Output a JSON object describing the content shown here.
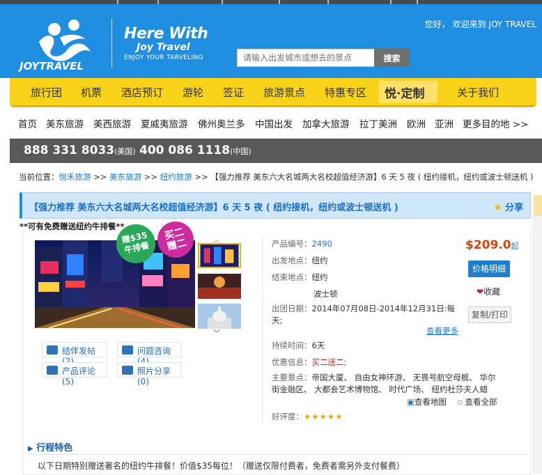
{
  "header": {
    "logo_text": "JOYTRAVEL",
    "slogan_line1": "Here With",
    "slogan_line2": "Joy Travel",
    "slogan_line3": "ENJOY YOUR TARVELING",
    "welcome": "您好， 欢迎来到 JOY TRAVEL",
    "search_placeholder": "请输入出发城市或想去的景点",
    "search_button": "搜索"
  },
  "main_nav": {
    "items": [
      "旅行团",
      "机票",
      "酒店预订",
      "游轮",
      "签证",
      "旅游景点",
      "特惠专区",
      "关于我们"
    ],
    "special": "悦·定制"
  },
  "sub_nav": {
    "items": [
      "首页",
      "美东旅游",
      "美西旅游",
      "夏威夷旅游",
      "佛州奥兰多",
      "中国出发",
      "加拿大旅游",
      "拉丁美洲",
      "欧洲",
      "亚洲",
      "更多目的地 >>"
    ]
  },
  "phones": [
    {
      "number": "888 331 8033",
      "region": "(美国)"
    },
    {
      "number": "400 086 1118",
      "region": "(中国)"
    }
  ],
  "breadcrumb": {
    "prefix": "当前位置：",
    "links": [
      "悦禾旅游",
      "美东旅游",
      "纽约旅游"
    ],
    "sep": " >> ",
    "current": "【强力推荐 美东六大名城两大名校超值经济游】6 天 5 夜 ( 纽约接机，纽约或波士顿送机 )"
  },
  "product": {
    "title": "【强力推荐 美东六大名城两大名校超值经济游】6 天 5 夜 ( 纽约接机，纽约或波士顿送机 )",
    "share": "分享",
    "gift_note": "**可有免费赠送纽约牛排餐**",
    "badge1_line1": "赠$35",
    "badge1_line2": "牛排餐",
    "badge2_line1": "买二",
    "badge2_line2": "赠二",
    "actions": [
      {
        "label": "结伴发帖(2)"
      },
      {
        "label": "问题咨询(4)"
      },
      {
        "label": "产品评论(5)"
      },
      {
        "label": "照片分享(0)"
      }
    ],
    "code_label": "产品编号：",
    "code": "2490",
    "depart_label": "出发地点：",
    "depart": "纽约",
    "end_label": "结束地点：",
    "end1": "纽约",
    "end2": "波士顿",
    "date_label": "出团日期：",
    "date_line1": "2014年07月08日-2014年12月31日:每",
    "date_line2": "天;",
    "more": "查看更多",
    "duration_label": "持续时间：",
    "duration": "6天",
    "promo_label": "优惠信息：",
    "promo": "买二送二;",
    "spots_label": "主要景点：",
    "spots_line1": "帝国大厦、 自由女神环游、 无畏号航空母舰、 华尔",
    "spots_line2": "街金融区、 大都会艺术博物馆、 时代广场、 纽约杜莎夫人蜡",
    "map_link": "查看地图",
    "all_link": "查看全部",
    "rating_label": "好评度：",
    "rating": 5,
    "price": "$209.0",
    "price_suffix": "起",
    "price_detail": "价格明细",
    "fav": "收藏",
    "copy_print": "复制/打印"
  },
  "section": {
    "heading": "行程特色",
    "text": "以下日期特别赠送著名的纽约牛排餐！价值$35每位！（赠送仅限付费者，免费者需另外支付餐费）"
  },
  "colors": {
    "header_blue": "#1f8ee0",
    "nav_yellow": "#f9d21a",
    "phone_bar": "#585858",
    "price_red": "#e04000",
    "link_blue": "#1a7ad0"
  }
}
